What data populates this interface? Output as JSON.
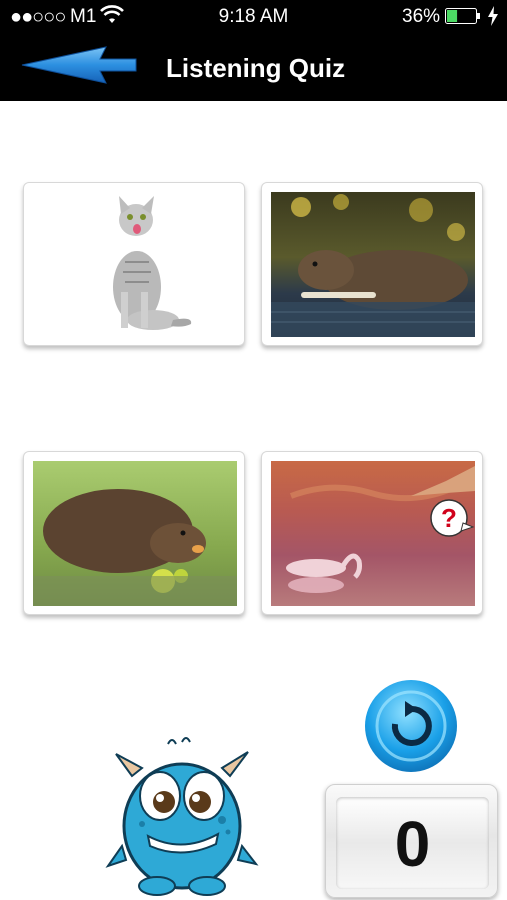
{
  "status_bar": {
    "signal": "●●○○○",
    "carrier": "M1",
    "time": "9:18 AM",
    "battery_percent": "36%",
    "battery_level": 0.36
  },
  "nav": {
    "title": "Listening Quiz",
    "back_icon": "blue-arrow-left-icon"
  },
  "answer_cards": [
    {
      "subject": "cat"
    },
    {
      "subject": "beaver"
    },
    {
      "subject": "nutria"
    },
    {
      "subject": "flamingo-question"
    }
  ],
  "replay_icon": "replay-icon",
  "score": "0",
  "mascot": "blue-monster",
  "colors": {
    "nav_bg": "#000000",
    "arrow_blue": "#2c8fe0",
    "replay_blue": "#1aa0e8",
    "monster_blue": "#2ea9d6"
  }
}
